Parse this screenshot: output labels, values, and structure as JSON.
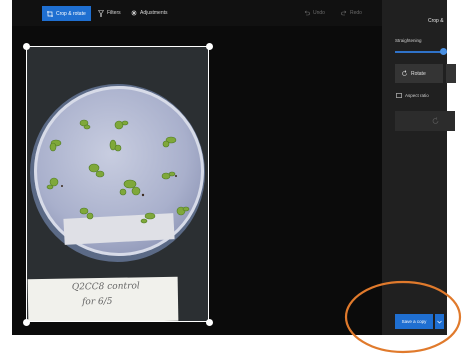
{
  "toolbar": {
    "crop_rotate_label": "Crop & rotate",
    "filters_label": "Filters",
    "adjustments_label": "Adjustments",
    "undo_label": "Undo",
    "redo_label": "Redo"
  },
  "photo": {
    "handwriting_line1": "Q2CC8 control",
    "handwriting_line2": "for 6/5"
  },
  "panel": {
    "title": "Crop &",
    "straighten_label": "Straightening",
    "straighten_value": 1.0,
    "rotate_label": "Rotate",
    "aspect_ratio_label": "Aspect ratio",
    "save_label": "Save a copy"
  },
  "colors": {
    "accent": "#1f6fd1",
    "annotation": "#e07a2c",
    "background": "#0b0b0b",
    "panel": "#202020"
  },
  "icons": [
    "crop-rotate-icon",
    "filters-icon",
    "adjustments-icon",
    "undo-icon",
    "redo-icon",
    "rotate-icon",
    "aspect-ratio-icon",
    "flip-icon",
    "chevron-down-icon"
  ]
}
